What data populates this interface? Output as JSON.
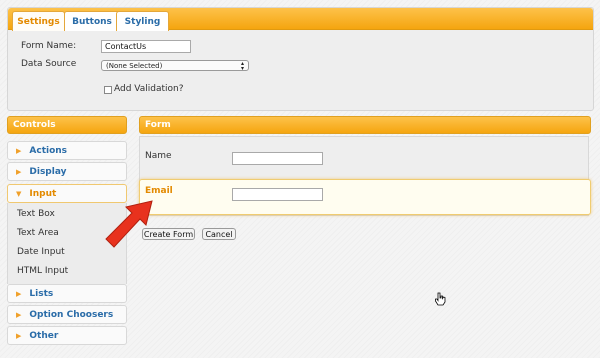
{
  "tabs": {
    "settings": "Settings",
    "buttons": "Buttons",
    "styling": "Styling"
  },
  "settings": {
    "form_name_label": "Form Name:",
    "form_name_value": "ContactUs",
    "data_source_label": "Data Source",
    "data_source_value": "(None Selected)",
    "add_validation_label": "Add Validation?"
  },
  "controls": {
    "header": "Controls",
    "items": {
      "actions": "Actions",
      "display": "Display",
      "input": "Input",
      "lists": "Lists",
      "option_choosers": "Option Choosers",
      "other": "Other"
    },
    "input_sub_items": {
      "text_box": "Text Box",
      "text_area": "Text Area",
      "date_input": "Date Input",
      "html_input": "HTML Input"
    }
  },
  "form": {
    "header": "Form",
    "name_label": "Name",
    "email_label": "Email",
    "create_button": "Create Form",
    "cancel_button": "Cancel"
  },
  "colors": {
    "accent_orange": "#f5a50f",
    "link_blue": "#2a6ca8",
    "arrow_red": "#e8321e"
  }
}
